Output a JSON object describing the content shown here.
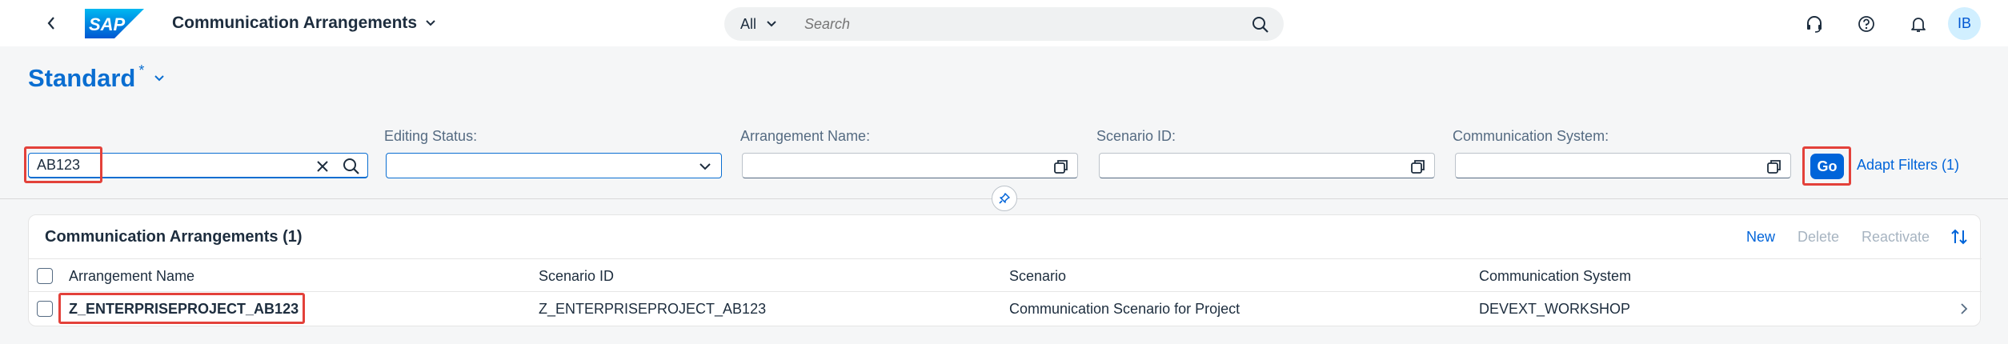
{
  "shell": {
    "app_title": "Communication Arrangements",
    "search_scope": "All",
    "search_placeholder": "Search",
    "avatar_initials": "IB",
    "icons": [
      "back-icon",
      "sap-logo",
      "chevron-down-icon",
      "search-icon",
      "headset-icon",
      "help-icon",
      "bell-icon"
    ]
  },
  "variant": {
    "title": "Standard",
    "modified_marker": "*"
  },
  "filters": {
    "basic_search_value": "AB123",
    "editing_status_label": "Editing Status:",
    "editing_status_value": "",
    "arrangement_name_label": "Arrangement Name:",
    "arrangement_name_value": "",
    "scenario_id_label": "Scenario ID:",
    "scenario_id_value": "",
    "communication_system_label": "Communication System:",
    "communication_system_value": "",
    "go_label": "Go",
    "adapt_filters_label": "Adapt Filters (1)"
  },
  "table": {
    "title": "Communication Arrangements (1)",
    "toolbar": {
      "new_label": "New",
      "delete_label": "Delete",
      "reactivate_label": "Reactivate"
    },
    "columns": [
      "Arrangement Name",
      "Scenario ID",
      "Scenario",
      "Communication System"
    ],
    "rows": [
      [
        "Z_ENTERPRISEPROJECT_AB123",
        "Z_ENTERPRISEPROJECT_AB123",
        "Communication Scenario for Project",
        "DEVEXT_WORKSHOP"
      ]
    ]
  },
  "colors": {
    "accent": "#0064d9",
    "highlight": "#e3413a",
    "disabled": "#a7b4c1"
  }
}
